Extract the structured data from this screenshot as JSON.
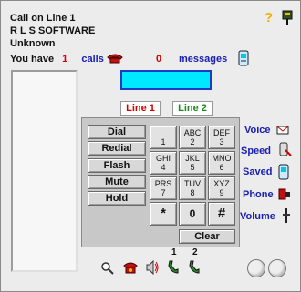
{
  "caller": {
    "line_status": "Call on Line 1",
    "name": "R L S SOFTWARE",
    "number": "Unknown"
  },
  "summary": {
    "you_have": "You have",
    "calls_count": "1",
    "calls_label": "calls",
    "messages_count": "0",
    "messages_label": "messages"
  },
  "display": {
    "value": ""
  },
  "lines": [
    {
      "label": "Line 1",
      "active": true
    },
    {
      "label": "Line 2",
      "active": false
    }
  ],
  "functions": [
    "Dial",
    "Redial",
    "Flash",
    "Mute",
    "Hold"
  ],
  "keypad": [
    {
      "letters": "",
      "digit": "1"
    },
    {
      "letters": "ABC",
      "digit": "2"
    },
    {
      "letters": "DEF",
      "digit": "3"
    },
    {
      "letters": "GHI",
      "digit": "4"
    },
    {
      "letters": "JKL",
      "digit": "5"
    },
    {
      "letters": "MNO",
      "digit": "6"
    },
    {
      "letters": "PRS",
      "digit": "7"
    },
    {
      "letters": "TUV",
      "digit": "8"
    },
    {
      "letters": "XYZ",
      "digit": "9"
    },
    {
      "letters": "",
      "digit": "*"
    },
    {
      "letters": "",
      "digit": "0"
    },
    {
      "letters": "",
      "digit": "#"
    }
  ],
  "clear_label": "Clear",
  "side_buttons": [
    "Voice",
    "Speed",
    "Saved",
    "Phone",
    "Volume"
  ],
  "bottom": {
    "line1_num": "1",
    "line2_num": "2"
  },
  "colors": {
    "accent_red": "#d40000",
    "accent_blue": "#1a20b0",
    "lcd": "#00e8ff"
  },
  "icons": [
    "help-icon",
    "pin-icon",
    "phone-icon",
    "message-icon",
    "search-icon",
    "ringer-icon",
    "speaker-icon",
    "handset-1-icon",
    "handset-2-icon"
  ]
}
